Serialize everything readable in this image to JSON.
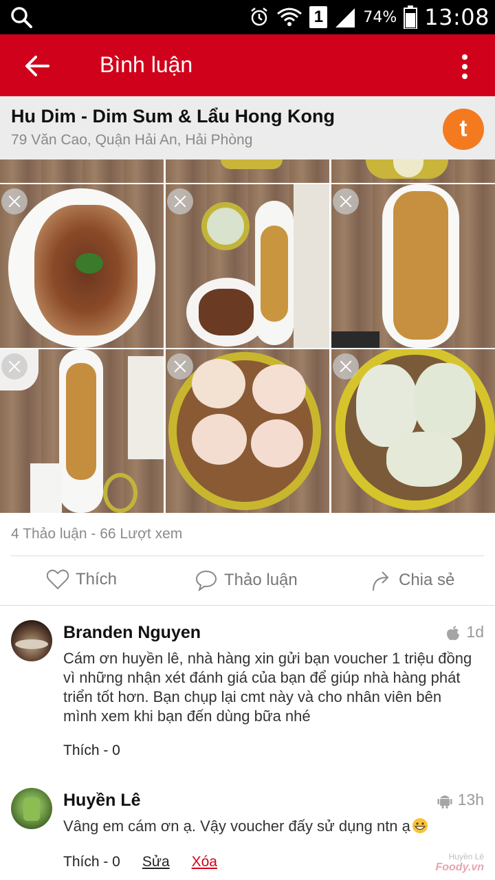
{
  "status_bar": {
    "battery": "74%",
    "time": "13:08",
    "sim_slot": "1",
    "icons": [
      "search-icon",
      "alarm-icon",
      "wifi-icon",
      "sim-1-icon",
      "signal-icon",
      "battery-icon"
    ]
  },
  "app_bar": {
    "title": "Bình luận",
    "background": "#d0021b"
  },
  "restaurant": {
    "name": "Hu Dim - Dim Sum & Lẩu Hong Kong",
    "address": "79 Văn Cao, Quận Hải An, Hải Phòng",
    "badge_letter": "t",
    "badge_color": "#f47a20"
  },
  "photos": {
    "count": 6,
    "description_free": true
  },
  "stats": {
    "text": "4 Thảo luận - 66 Lượt xem"
  },
  "actions": {
    "like": "Thích",
    "discuss": "Thảo luận",
    "share": "Chia sẻ"
  },
  "comments": [
    {
      "author": "Branden Nguyen",
      "time": "1d",
      "platform_icon": "apple-icon",
      "text": "Cám ơn huyền lê, nhà hàng xin gửi bạn voucher 1 triệu đồng vì những nhận xét đánh giá của bạn để giúp nhà hàng phát triển tốt hơn. Bạn chụp lại cmt này và cho nhân viên bên mình xem khi bạn đến dùng bữa nhé",
      "likes": "Thích - 0"
    },
    {
      "author": "Huyền Lê",
      "time": "13h",
      "platform_icon": "android-icon",
      "text": "Vâng em cám ơn ạ. Vậy voucher đấy sử dụng ntn ạ",
      "likes": "Thích - 0",
      "edit": "Sửa",
      "delete": "Xóa"
    }
  ],
  "watermark": {
    "user": "Huyền Lê",
    "logo": "Foody.vn"
  }
}
